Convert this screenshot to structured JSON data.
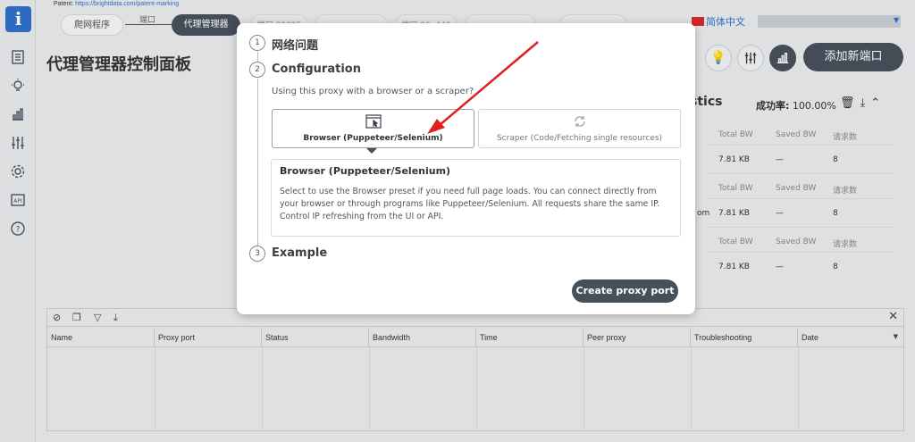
{
  "topbar": {
    "patent_prefix": "Patent:",
    "patent_link": "https://brightdata.com/patent-marking",
    "crumb_scraper": "爬网程序",
    "crumb_link_port": "端口",
    "crumb_proxy_manager": "代理管理器",
    "ghost_tab_1": "端口 22225",
    "ghost_tab_2": "端口 80, 443",
    "language": "简体中文",
    "add_port_label": "添加新端口"
  },
  "page": {
    "title": "代理管理器控制面板"
  },
  "stats": {
    "title": "stics",
    "success_label": "成功率:",
    "success_value": "100.00%",
    "headers": [
      "Total BW",
      "Saved BW",
      "请求数"
    ],
    "rows": [
      {
        "total_bw": "7.81 KB",
        "saved_bw": "—",
        "requests": "8"
      },
      {
        "prefix": "om",
        "total_bw": "7.81 KB",
        "saved_bw": "—",
        "requests": "8"
      },
      {
        "total_bw": "7.81 KB",
        "saved_bw": "—",
        "requests": "8"
      }
    ]
  },
  "table": {
    "columns": [
      "Name",
      "Proxy port",
      "Status",
      "Bandwidth",
      "Time",
      "Peer proxy",
      "Troubleshooting",
      "Date"
    ]
  },
  "modal": {
    "step1_number": "1",
    "step1_title": "网络问题",
    "step2_number": "2",
    "step2_title": "Configuration",
    "question": "Using this proxy with a browser or a scraper?",
    "option_browser": "Browser (Puppeteer/Selenium)",
    "option_scraper": "Scraper (Code/Fetching single resources)",
    "desc_title": "Browser (Puppeteer/Selenium)",
    "desc_text": "Select to use the Browser preset if you need full page loads. You can connect directly from your browser or through programs like Puppeteer/Selenium. All requests share the same IP. Control IP refreshing from the UI or API.",
    "step3_number": "3",
    "step3_title": "Example",
    "create_button": "Create proxy port"
  },
  "colors": {
    "accent_dark": "#46505b",
    "brand_blue": "#2f6fc9",
    "annotation_red": "#e02020"
  }
}
